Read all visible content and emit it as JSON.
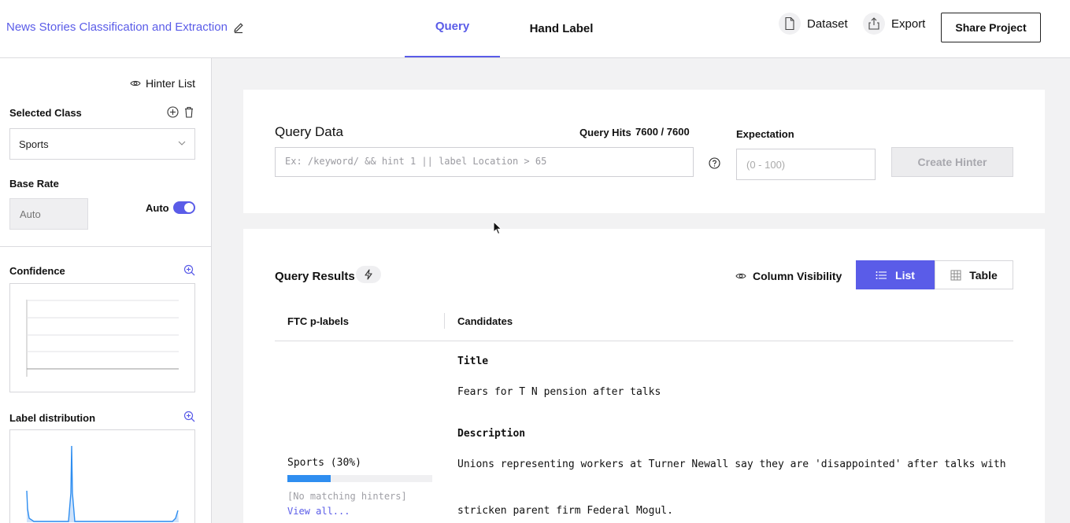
{
  "header": {
    "project_title": "News Stories Classification and Extraction",
    "tabs": [
      {
        "label": "Query",
        "active": true
      },
      {
        "label": "Hand Label",
        "active": false
      }
    ],
    "dataset_label": "Dataset",
    "export_label": "Export",
    "share_label": "Share Project"
  },
  "sidebar": {
    "hinter_list_label": "Hinter List",
    "selected_class_label": "Selected Class",
    "selected_class_value": "Sports",
    "base_rate_label": "Base Rate",
    "base_rate_placeholder": "Auto",
    "auto_label": "Auto",
    "auto_enabled": true,
    "confidence_label": "Confidence",
    "label_distribution_label": "Label distribution"
  },
  "query_data": {
    "title": "Query Data",
    "hits_label": "Query Hits",
    "hits_value": "7600 / 7600",
    "input_placeholder": "Ex: /keyword/ && hint 1 || label Location > 65",
    "expectation_label": "Expectation",
    "expectation_placeholder": "(0 - 100)",
    "create_button": "Create Hinter"
  },
  "query_results": {
    "title": "Query Results",
    "column_visibility": "Column Visibility",
    "list_label": "List",
    "table_label": "Table",
    "columns": [
      "FTC p-labels",
      "Candidates"
    ],
    "row": {
      "title_heading": "Title",
      "title_value": "Fears for T N pension after talks",
      "description_heading": "Description",
      "description_line1": "Unions representing workers at Turner Newall say they are 'disappointed' after talks with",
      "description_line2": "stricken parent firm Federal Mogul.",
      "plabel": "Sports (30%)",
      "plabel_fraction": 0.3,
      "no_matching": "[No matching hinters]",
      "view_all": "View all..."
    }
  },
  "colors": {
    "accent": "#5a5ce8",
    "bar_fill": "#2f8ef0",
    "distribution_line": "#2f8ef0"
  }
}
